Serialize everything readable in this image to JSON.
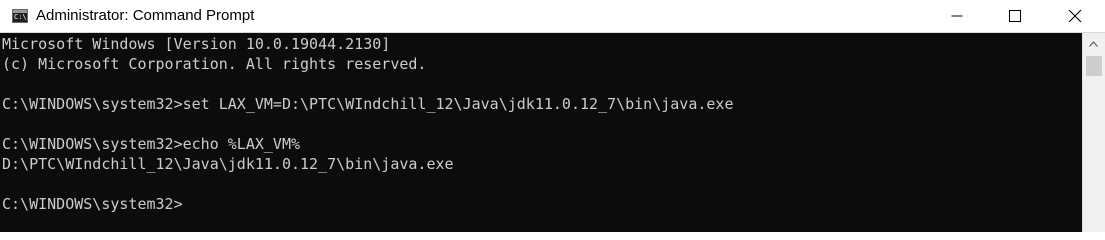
{
  "window": {
    "title": "Administrator: Command Prompt",
    "app_icon_glyph": "C:\\.",
    "icons": {
      "app": "command-prompt-icon",
      "minimize": "minimize-icon",
      "maximize": "maximize-icon",
      "close": "close-icon",
      "scroll_up": "chevron-up-icon"
    }
  },
  "console": {
    "background": "#0c0c0c",
    "foreground": "#cccccc",
    "lines": [
      "Microsoft Windows [Version 10.0.19044.2130]",
      "(c) Microsoft Corporation. All rights reserved.",
      "",
      "C:\\WINDOWS\\system32>set LAX_VM=D:\\PTC\\WIndchill_12\\Java\\jdk11.0.12_7\\bin\\java.exe",
      "",
      "C:\\WINDOWS\\system32>echo %LAX_VM%",
      "D:\\PTC\\WIndchill_12\\Java\\jdk11.0.12_7\\bin\\java.exe",
      "",
      "C:\\WINDOWS\\system32>"
    ]
  }
}
